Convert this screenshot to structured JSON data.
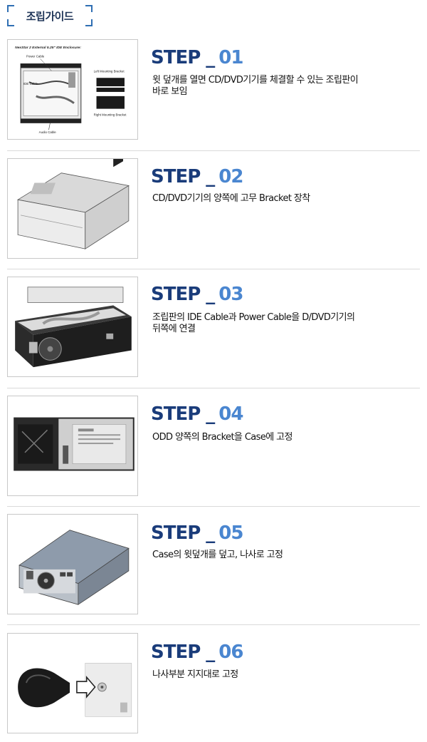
{
  "header": {
    "title": "조립가이드"
  },
  "steps": [
    {
      "keyword": "STEP",
      "sep": "_",
      "number": "01",
      "lines": [
        "윗 덮개를 열면 CD/DVD기기를 체결할 수 있는 조립판이",
        "바로 보임"
      ],
      "figure": {
        "title": "NexStar 2 External 5.25\" IDE Enclosure:",
        "labels": [
          "Power Cable",
          "IDE Cable",
          "Audio Cable",
          "Left Mounting Bracket",
          "Right Mounting Bracket"
        ]
      }
    },
    {
      "keyword": "STEP",
      "sep": "_",
      "number": "02",
      "lines": [
        "CD/DVD기기의 양쪽에 고무 Bracket 장착"
      ]
    },
    {
      "keyword": "STEP",
      "sep": "_",
      "number": "03",
      "lines": [
        "조립판의 IDE Cable과 Power Cable을  D/DVD기기의",
        "뒤쪽에 연결"
      ]
    },
    {
      "keyword": "STEP",
      "sep": "_",
      "number": "04",
      "lines": [
        "ODD 양쪽의 Bracket을  Case에 고정"
      ]
    },
    {
      "keyword": "STEP",
      "sep": "_",
      "number": "05",
      "lines": [
        "Case의 윗덮개를 덮고, 나사로 고정"
      ]
    },
    {
      "keyword": "STEP",
      "sep": "_",
      "number": "06",
      "lines": [
        "나사부분 지지대로 고정"
      ]
    }
  ],
  "colors": {
    "title_dark": "#1a3c7a",
    "title_number": "#4a86d0",
    "header_bracket": "#2f6fb3"
  }
}
